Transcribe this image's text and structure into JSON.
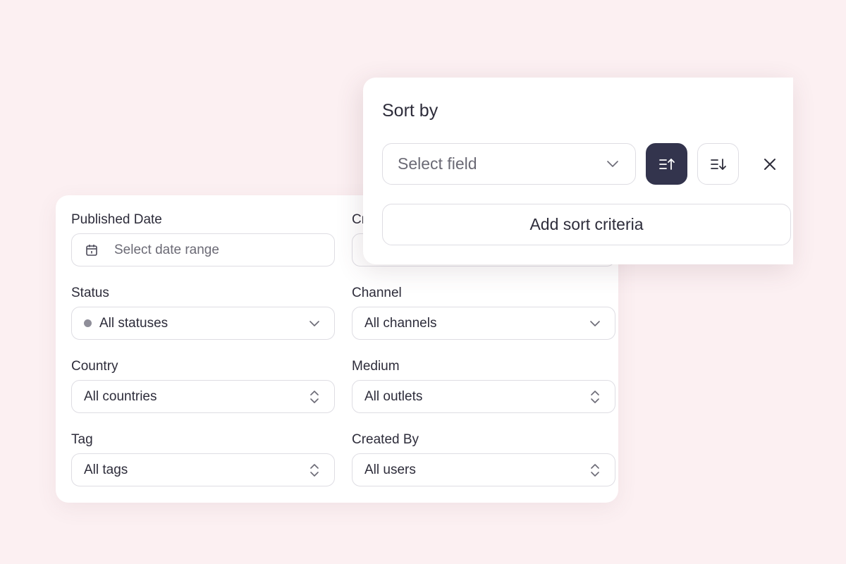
{
  "filters": {
    "published_date": {
      "label": "Published Date",
      "placeholder": "Select date range"
    },
    "created_date": {
      "label": "Cr"
    },
    "status": {
      "label": "Status",
      "value": "All statuses"
    },
    "channel": {
      "label": "Channel",
      "value": "All channels"
    },
    "country": {
      "label": "Country",
      "value": "All countries"
    },
    "medium": {
      "label": "Medium",
      "value": "All outlets"
    },
    "tag": {
      "label": "Tag",
      "value": "All tags"
    },
    "created_by": {
      "label": "Created By",
      "value": "All users"
    }
  },
  "sort": {
    "title": "Sort by",
    "field_placeholder": "Select field",
    "add_label": "Add sort criteria"
  },
  "icons": {
    "date": "calendar-icon",
    "status": "status-dot-icon",
    "dropdown": "chevron-down-icon",
    "updown": "chevron-updown-icon",
    "asc": "sort-ascending-icon",
    "desc": "sort-descending-icon",
    "close": "close-icon"
  },
  "colors": {
    "background": "#fcf0f2",
    "accent": "#33344d",
    "text": "#2d2c3a",
    "border": "#dedde3"
  }
}
